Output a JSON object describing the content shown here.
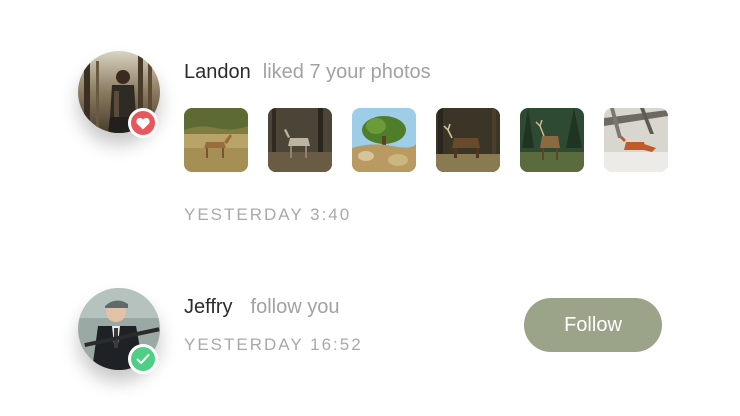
{
  "notifications": [
    {
      "name": "Landon",
      "action": "liked 7 your photos",
      "time": "YESTERDAY 3:40",
      "badge_icon": "heart-icon",
      "badge_color": "#e8575b",
      "photos": [
        {
          "subject": "deer in tall grass"
        },
        {
          "subject": "deer in dark woods"
        },
        {
          "subject": "tree on rocky hill"
        },
        {
          "subject": "elk in forest"
        },
        {
          "subject": "elk among pines"
        },
        {
          "subject": "fox in snow"
        }
      ]
    },
    {
      "name": "Jeffry",
      "action": "follow you",
      "time": "YESTERDAY 16:52",
      "badge_icon": "check-icon",
      "badge_color": "#4ecf85",
      "button_label": "Follow",
      "button_color": "#9ba389"
    }
  ]
}
